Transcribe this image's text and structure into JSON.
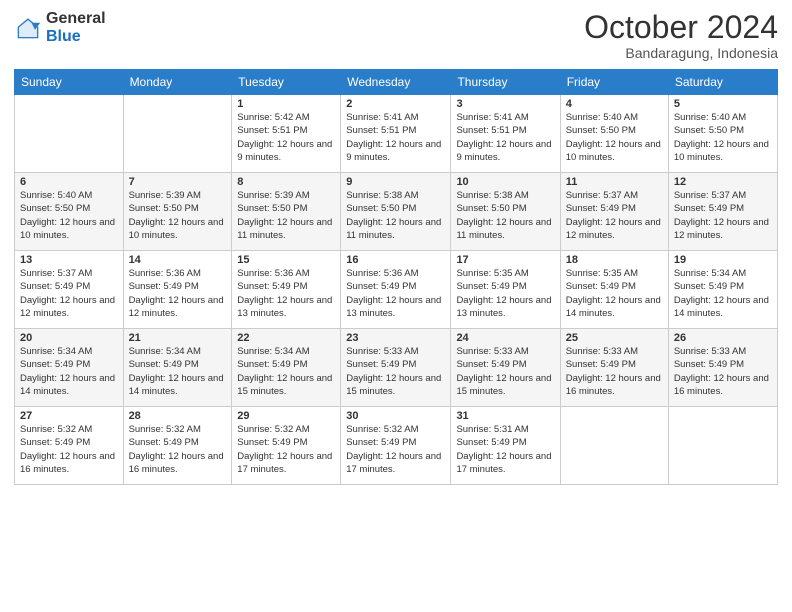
{
  "logo": {
    "general": "General",
    "blue": "Blue"
  },
  "header": {
    "month": "October 2024",
    "location": "Bandaragung, Indonesia"
  },
  "days_of_week": [
    "Sunday",
    "Monday",
    "Tuesday",
    "Wednesday",
    "Thursday",
    "Friday",
    "Saturday"
  ],
  "weeks": [
    [
      {
        "day": "",
        "info": ""
      },
      {
        "day": "",
        "info": ""
      },
      {
        "day": "1",
        "info": "Sunrise: 5:42 AM\nSunset: 5:51 PM\nDaylight: 12 hours and 9 minutes."
      },
      {
        "day": "2",
        "info": "Sunrise: 5:41 AM\nSunset: 5:51 PM\nDaylight: 12 hours and 9 minutes."
      },
      {
        "day": "3",
        "info": "Sunrise: 5:41 AM\nSunset: 5:51 PM\nDaylight: 12 hours and 9 minutes."
      },
      {
        "day": "4",
        "info": "Sunrise: 5:40 AM\nSunset: 5:50 PM\nDaylight: 12 hours and 10 minutes."
      },
      {
        "day": "5",
        "info": "Sunrise: 5:40 AM\nSunset: 5:50 PM\nDaylight: 12 hours and 10 minutes."
      }
    ],
    [
      {
        "day": "6",
        "info": "Sunrise: 5:40 AM\nSunset: 5:50 PM\nDaylight: 12 hours and 10 minutes."
      },
      {
        "day": "7",
        "info": "Sunrise: 5:39 AM\nSunset: 5:50 PM\nDaylight: 12 hours and 10 minutes."
      },
      {
        "day": "8",
        "info": "Sunrise: 5:39 AM\nSunset: 5:50 PM\nDaylight: 12 hours and 11 minutes."
      },
      {
        "day": "9",
        "info": "Sunrise: 5:38 AM\nSunset: 5:50 PM\nDaylight: 12 hours and 11 minutes."
      },
      {
        "day": "10",
        "info": "Sunrise: 5:38 AM\nSunset: 5:50 PM\nDaylight: 12 hours and 11 minutes."
      },
      {
        "day": "11",
        "info": "Sunrise: 5:37 AM\nSunset: 5:49 PM\nDaylight: 12 hours and 12 minutes."
      },
      {
        "day": "12",
        "info": "Sunrise: 5:37 AM\nSunset: 5:49 PM\nDaylight: 12 hours and 12 minutes."
      }
    ],
    [
      {
        "day": "13",
        "info": "Sunrise: 5:37 AM\nSunset: 5:49 PM\nDaylight: 12 hours and 12 minutes."
      },
      {
        "day": "14",
        "info": "Sunrise: 5:36 AM\nSunset: 5:49 PM\nDaylight: 12 hours and 12 minutes."
      },
      {
        "day": "15",
        "info": "Sunrise: 5:36 AM\nSunset: 5:49 PM\nDaylight: 12 hours and 13 minutes."
      },
      {
        "day": "16",
        "info": "Sunrise: 5:36 AM\nSunset: 5:49 PM\nDaylight: 12 hours and 13 minutes."
      },
      {
        "day": "17",
        "info": "Sunrise: 5:35 AM\nSunset: 5:49 PM\nDaylight: 12 hours and 13 minutes."
      },
      {
        "day": "18",
        "info": "Sunrise: 5:35 AM\nSunset: 5:49 PM\nDaylight: 12 hours and 14 minutes."
      },
      {
        "day": "19",
        "info": "Sunrise: 5:34 AM\nSunset: 5:49 PM\nDaylight: 12 hours and 14 minutes."
      }
    ],
    [
      {
        "day": "20",
        "info": "Sunrise: 5:34 AM\nSunset: 5:49 PM\nDaylight: 12 hours and 14 minutes."
      },
      {
        "day": "21",
        "info": "Sunrise: 5:34 AM\nSunset: 5:49 PM\nDaylight: 12 hours and 14 minutes."
      },
      {
        "day": "22",
        "info": "Sunrise: 5:34 AM\nSunset: 5:49 PM\nDaylight: 12 hours and 15 minutes."
      },
      {
        "day": "23",
        "info": "Sunrise: 5:33 AM\nSunset: 5:49 PM\nDaylight: 12 hours and 15 minutes."
      },
      {
        "day": "24",
        "info": "Sunrise: 5:33 AM\nSunset: 5:49 PM\nDaylight: 12 hours and 15 minutes."
      },
      {
        "day": "25",
        "info": "Sunrise: 5:33 AM\nSunset: 5:49 PM\nDaylight: 12 hours and 16 minutes."
      },
      {
        "day": "26",
        "info": "Sunrise: 5:33 AM\nSunset: 5:49 PM\nDaylight: 12 hours and 16 minutes."
      }
    ],
    [
      {
        "day": "27",
        "info": "Sunrise: 5:32 AM\nSunset: 5:49 PM\nDaylight: 12 hours and 16 minutes."
      },
      {
        "day": "28",
        "info": "Sunrise: 5:32 AM\nSunset: 5:49 PM\nDaylight: 12 hours and 16 minutes."
      },
      {
        "day": "29",
        "info": "Sunrise: 5:32 AM\nSunset: 5:49 PM\nDaylight: 12 hours and 17 minutes."
      },
      {
        "day": "30",
        "info": "Sunrise: 5:32 AM\nSunset: 5:49 PM\nDaylight: 12 hours and 17 minutes."
      },
      {
        "day": "31",
        "info": "Sunrise: 5:31 AM\nSunset: 5:49 PM\nDaylight: 12 hours and 17 minutes."
      },
      {
        "day": "",
        "info": ""
      },
      {
        "day": "",
        "info": ""
      }
    ]
  ]
}
